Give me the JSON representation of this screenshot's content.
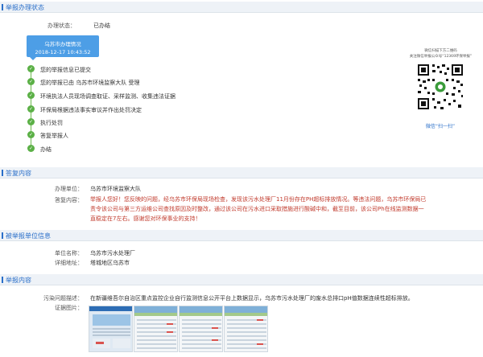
{
  "status_section": {
    "title": "举报办理状态",
    "status_label": "办理状态：",
    "status_value": "已办结",
    "city_box": {
      "title": "乌苏市办理情况",
      "datetime": "2018-12-17 10:43:52"
    },
    "steps": [
      "您的举报信息已提交",
      "您的举报已由 乌苏市环境监察大队 受理",
      "环境执法人员现场调查取证、采样监测、收集违法证据",
      "环保局根据违法事实审议并作出处罚决定",
      "执行处罚",
      "答复举报人",
      "办结"
    ],
    "qr": {
      "note_line1": "微信扫描下方二维码",
      "note_line2": "关注微信举报公众号“12369环保举报”",
      "cta": "微信“扫一扫”"
    }
  },
  "reply_section": {
    "title": "答复内容",
    "unit_label": "办理单位：",
    "unit_value": "乌苏市环境监察大队",
    "content_label": "答复内容：",
    "content_value": "举报人您好！您反映的问题，经乌苏市环保局现场检查，发现该污水处理厂11月份存在PH超标排放情况。等违法问题，乌苏市环保局已责令该公司与第三方运维公司查找原因及时整改，通过该公司在污水进口采取措施进行酸碱中和，截至目前，该公司Ph在线监测数据一直稳定在7左右。感谢您对环保事业的支持！"
  },
  "reported_unit_section": {
    "title": "被举报单位信息",
    "name_label": "单位名称：",
    "name_value": "乌苏市污水处理厂",
    "address_label": "详细地址：",
    "address_value": "塔城地区乌苏市"
  },
  "report_section": {
    "title": "举报内容",
    "problem_label": "污染问题描述：",
    "problem_value": "在新疆维吾尔自治区重点监控企业自行监测信息公开平台上数据显示，乌苏市污水处理厂的废水总排口pH值数据连续性超标排放。",
    "evidence_label": "证据图片："
  },
  "colors": {
    "accent": "#2a6fc9",
    "step_green": "#5bb046",
    "reply_red": "#c0392b",
    "city_box_blue": "#4d9ee6"
  },
  "icons": {
    "step": "check-circle-icon",
    "qr": "qr-code-icon"
  }
}
